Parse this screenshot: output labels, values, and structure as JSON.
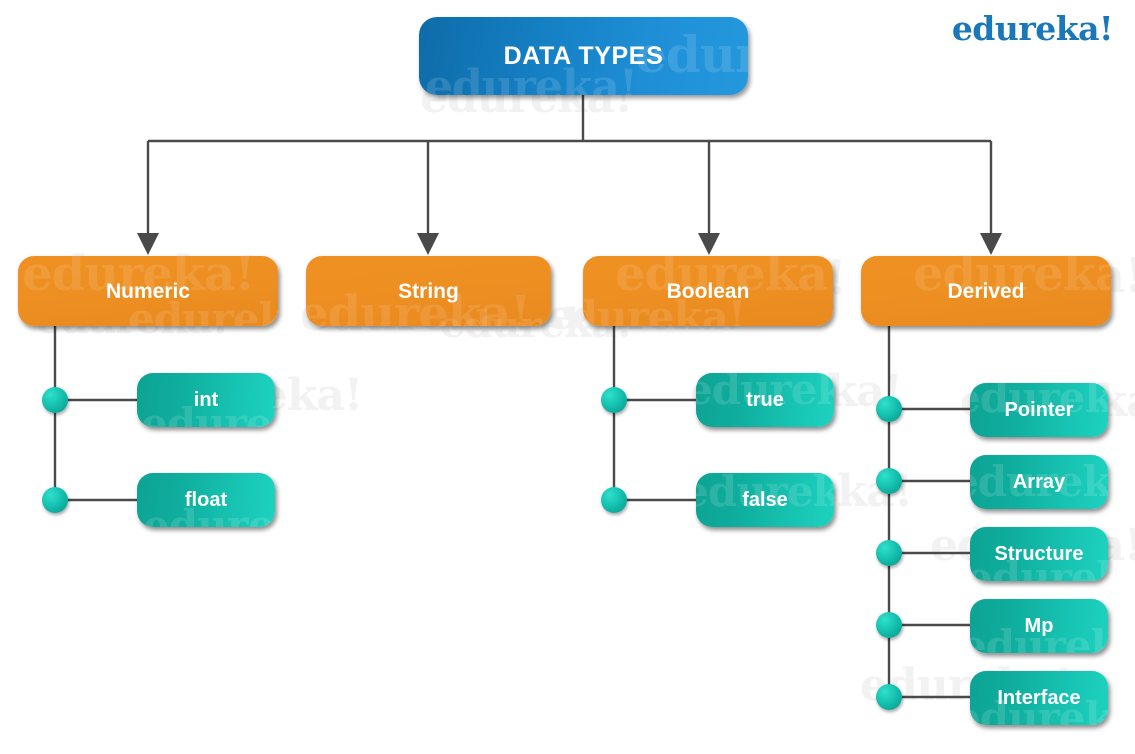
{
  "brand": {
    "logo_text": "edureka!",
    "logo_color": "#1b78b8"
  },
  "watermark": {
    "text": "edureka!"
  },
  "diagram": {
    "type": "tree",
    "root": {
      "label": "DATA TYPES",
      "color": "#1580c4"
    },
    "categories": [
      {
        "label": "Numeric",
        "color": "#ee8f22",
        "children": [
          {
            "label": "int",
            "color": "#12b5a5"
          },
          {
            "label": "float",
            "color": "#12b5a5"
          }
        ]
      },
      {
        "label": "String",
        "color": "#ee8f22",
        "children": []
      },
      {
        "label": "Boolean",
        "color": "#ee8f22",
        "children": [
          {
            "label": "true",
            "color": "#12b5a5"
          },
          {
            "label": "false",
            "color": "#12b5a5"
          }
        ]
      },
      {
        "label": "Derived",
        "color": "#ee8f22",
        "children": [
          {
            "label": "Pointer",
            "color": "#12b5a5"
          },
          {
            "label": "Array",
            "color": "#12b5a5"
          },
          {
            "label": "Structure",
            "color": "#12b5a5"
          },
          {
            "label": "Mp",
            "color": "#12b5a5"
          },
          {
            "label": "Interface",
            "color": "#12b5a5"
          }
        ]
      }
    ],
    "connector_color": "#4a4a4a"
  }
}
